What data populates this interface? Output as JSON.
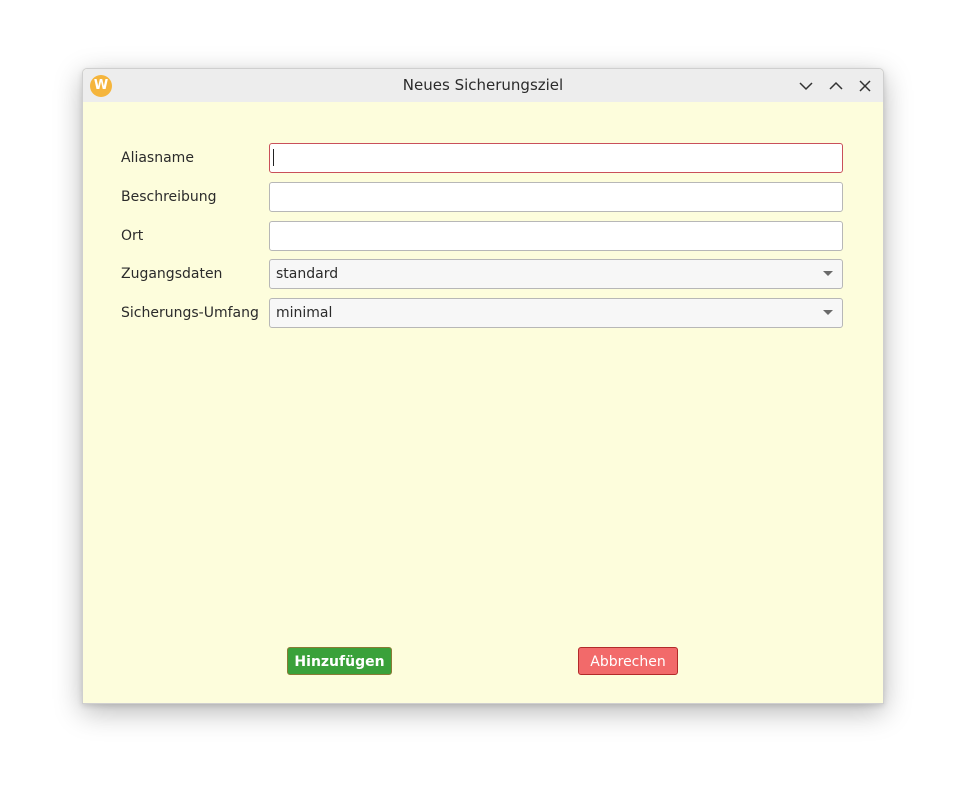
{
  "window": {
    "title": "Neues Sicherungsziel",
    "app_icon_letter": "W",
    "app_icon": "app-logo-icon",
    "controls": [
      "minimize-icon",
      "maximize-icon",
      "close-icon"
    ],
    "background_color": "#fdfddc"
  },
  "form": {
    "alias": {
      "label": "Aliasname",
      "value": ""
    },
    "description": {
      "label": "Beschreibung",
      "value": ""
    },
    "location": {
      "label": "Ort",
      "value": ""
    },
    "credentials": {
      "label": "Zugangsdaten",
      "selected": "standard"
    },
    "scope": {
      "label": "Sicherungs-Umfang",
      "selected": "minimal"
    }
  },
  "buttons": {
    "add": {
      "label": "Hinzufügen",
      "color": "#3aa13a"
    },
    "cancel": {
      "label": "Abbrechen",
      "color": "#f26a6a"
    }
  }
}
